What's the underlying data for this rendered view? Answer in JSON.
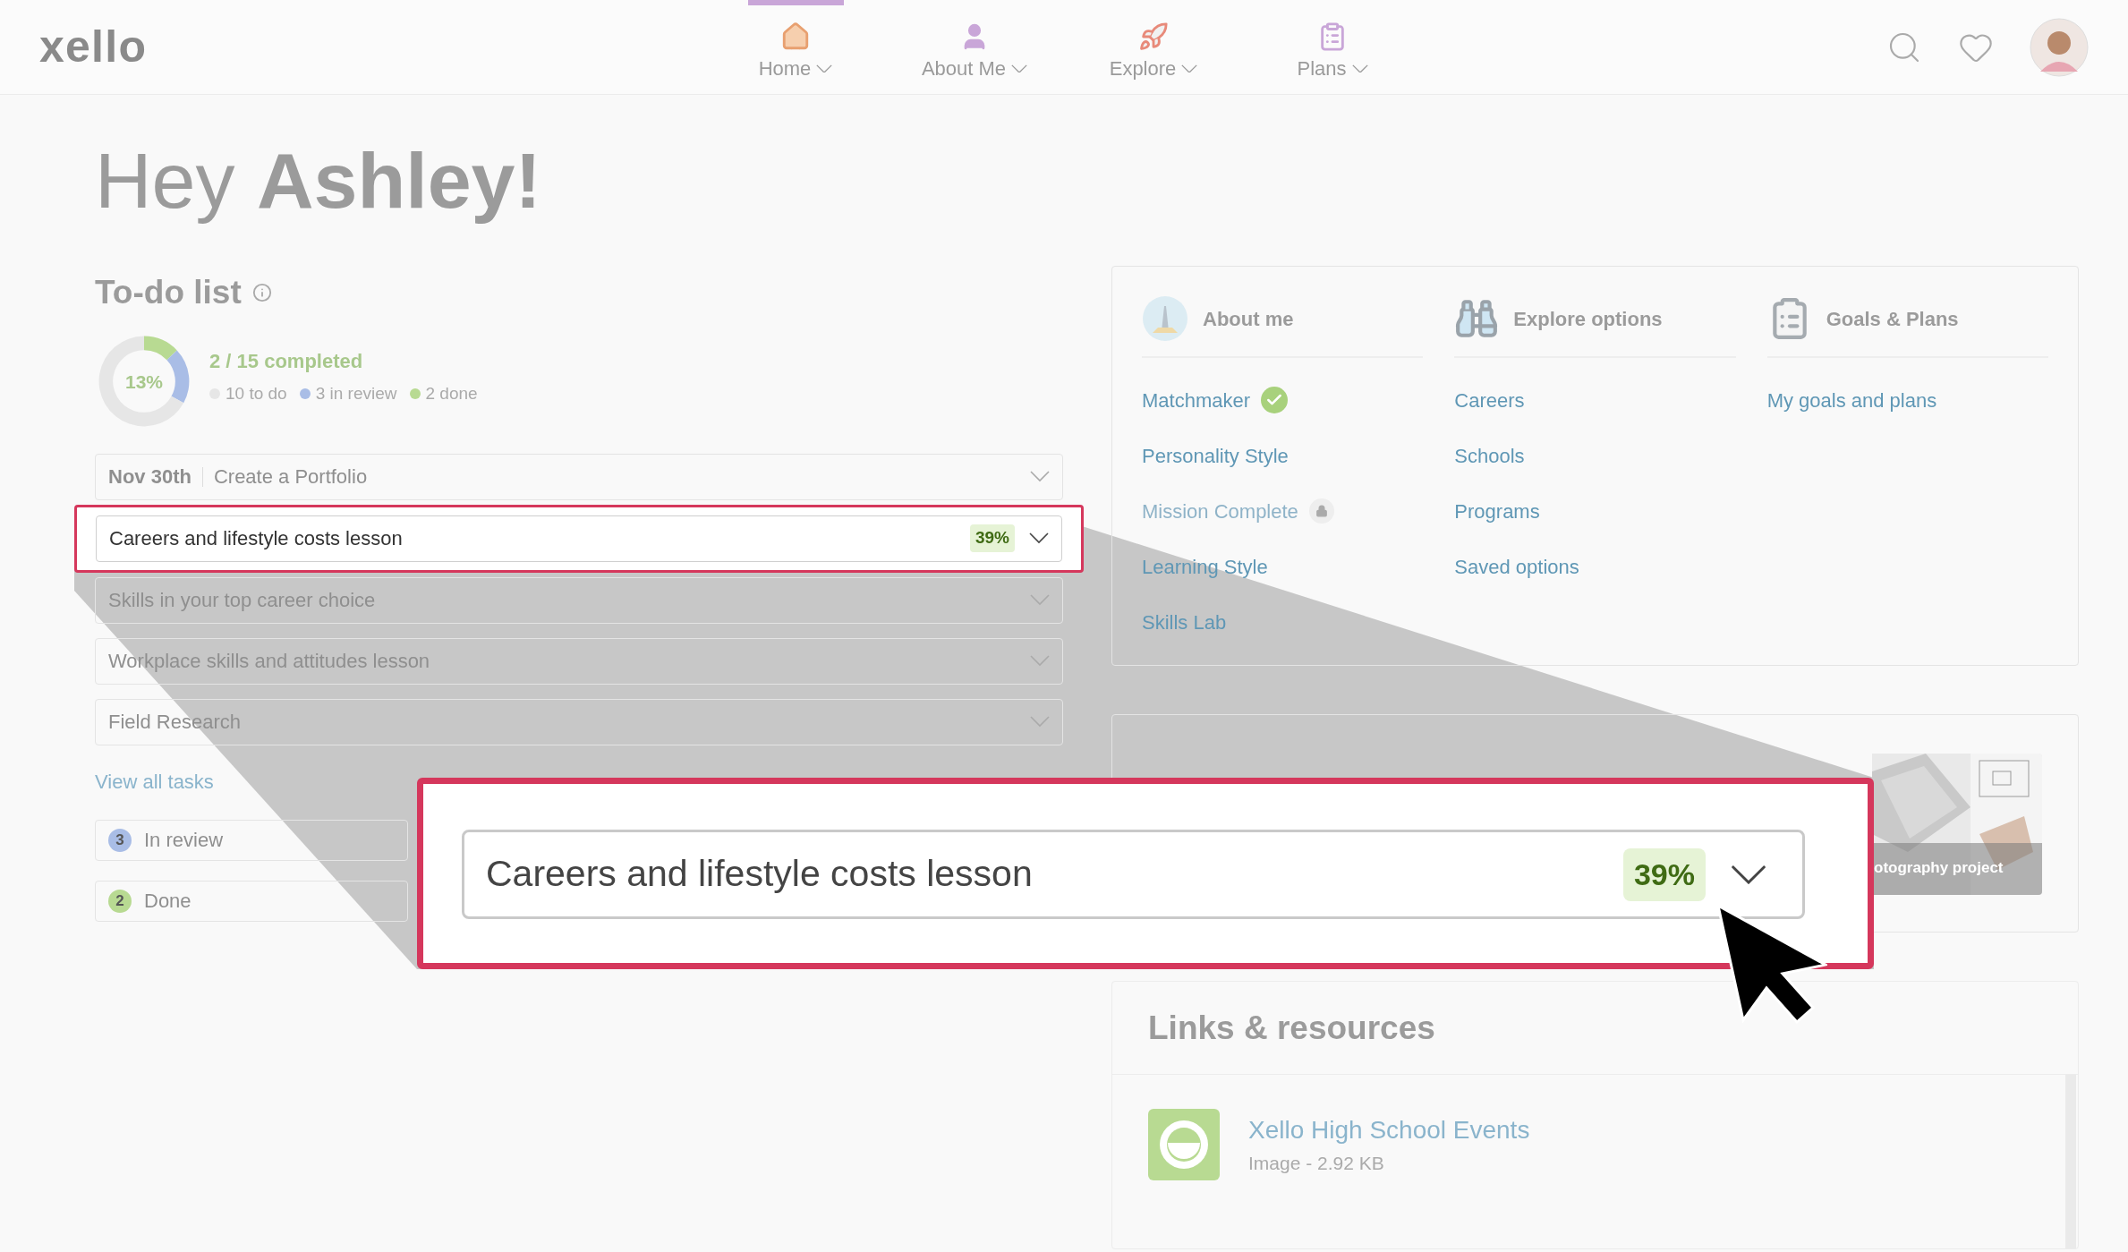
{
  "header": {
    "logo": "xello",
    "nav": [
      {
        "label": "Home",
        "kind": "house",
        "selected": true
      },
      {
        "label": "About Me",
        "kind": "person",
        "selected": false
      },
      {
        "label": "Explore",
        "kind": "rocket",
        "selected": false
      },
      {
        "label": "Plans",
        "kind": "clipboard",
        "selected": false
      }
    ]
  },
  "greeting": "Hey **Ashley!**",
  "todo": {
    "title": "To-do list",
    "percent": "13%",
    "completed": "2 / 15 completed",
    "chart_data": {
      "type": "donut",
      "values": [
        67,
        20,
        13
      ]
    },
    "legend": [
      {
        "label": "10 to do",
        "color": "#e6e6e6"
      },
      {
        "label": "3 in review",
        "color": "#a9bde6"
      },
      {
        "label": "2 done",
        "color": "#b8da92"
      }
    ],
    "tasks": [
      {
        "date": "Nov 30th",
        "title": "Create a Portfolio",
        "highlighted": false
      },
      {
        "title": "Careers and lifestyle costs lesson",
        "badge": "39%",
        "highlighted": true
      },
      {
        "title": "Skills in your top career choice",
        "highlighted": false
      },
      {
        "title": "Workplace skills and attitudes lesson",
        "highlighted": false
      },
      {
        "title": "Field Research",
        "highlighted": false
      }
    ],
    "view_all": "View all tasks",
    "groups": [
      {
        "count": "3",
        "label": "In review",
        "color": "#a9bde6"
      },
      {
        "count": "2",
        "label": "Done",
        "color": "#b8da92"
      }
    ]
  },
  "sections": [
    {
      "title": "About me",
      "kind": "tower",
      "links": [
        {
          "label": "Matchmaker",
          "kind": "complete"
        },
        {
          "label": "Personality Style",
          "kind": "link"
        },
        {
          "label": "Mission Complete",
          "kind": "locked"
        },
        {
          "label": "Learning Style",
          "kind": "link"
        },
        {
          "label": "Skills Lab",
          "kind": "link"
        }
      ]
    },
    {
      "title": "Explore options",
      "kind": "binoculars",
      "links": [
        {
          "label": "Careers",
          "kind": "link"
        },
        {
          "label": "Schools",
          "kind": "link"
        },
        {
          "label": "Programs",
          "kind": "link"
        },
        {
          "label": "Saved options",
          "kind": "link"
        }
      ]
    },
    {
      "title": "Goals & Plans",
      "kind": "clipboard",
      "links": [
        {
          "label": "My goals and plans",
          "kind": "link"
        }
      ]
    }
  ],
  "portfolio": {
    "caption": "otography project"
  },
  "resources": {
    "title": "Links & resources",
    "items": [
      {
        "title": "Xello High School Events",
        "meta": "Image - 2.92 KB"
      }
    ]
  },
  "callout": {
    "title": "Careers and lifestyle costs lesson",
    "badge": "39%"
  }
}
